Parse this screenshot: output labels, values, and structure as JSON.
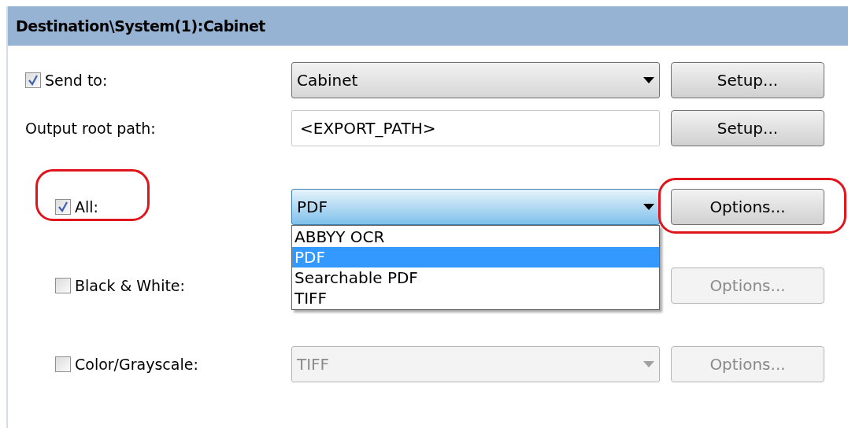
{
  "panel": {
    "title": "Destination\\System(1):Cabinet"
  },
  "rows": [
    {
      "kind": "destination",
      "checked": true,
      "label": "Send to:",
      "value": "Cabinet",
      "disabled": false,
      "button": {
        "label": "Setup...",
        "disabled": false
      },
      "highlighted": false
    },
    {
      "kind": "path",
      "label": "Output root path:",
      "value": "<EXPORT_PATH>",
      "button": {
        "label": "Setup...",
        "disabled": false
      },
      "highlighted": false
    },
    {
      "kind": "format",
      "checked": true,
      "label": "All:",
      "value": "PDF",
      "disabled": false,
      "expanded": true,
      "options": [
        {
          "label": "ABBYY OCR",
          "selected": false
        },
        {
          "label": "PDF",
          "selected": true
        },
        {
          "label": "Searchable PDF",
          "selected": false
        },
        {
          "label": "TIFF",
          "selected": false
        }
      ],
      "button": {
        "label": "Options...",
        "disabled": false
      },
      "highlighted": true
    },
    {
      "kind": "format",
      "checked": false,
      "label": "Black & White:",
      "button": {
        "label": "Options...",
        "disabled": true
      },
      "highlighted": false
    },
    {
      "kind": "format",
      "checked": false,
      "label": "Color/Grayscale:",
      "value": "TIFF",
      "disabled": true,
      "expanded": false,
      "button": {
        "label": "Options...",
        "disabled": true
      },
      "highlighted": false
    }
  ]
}
